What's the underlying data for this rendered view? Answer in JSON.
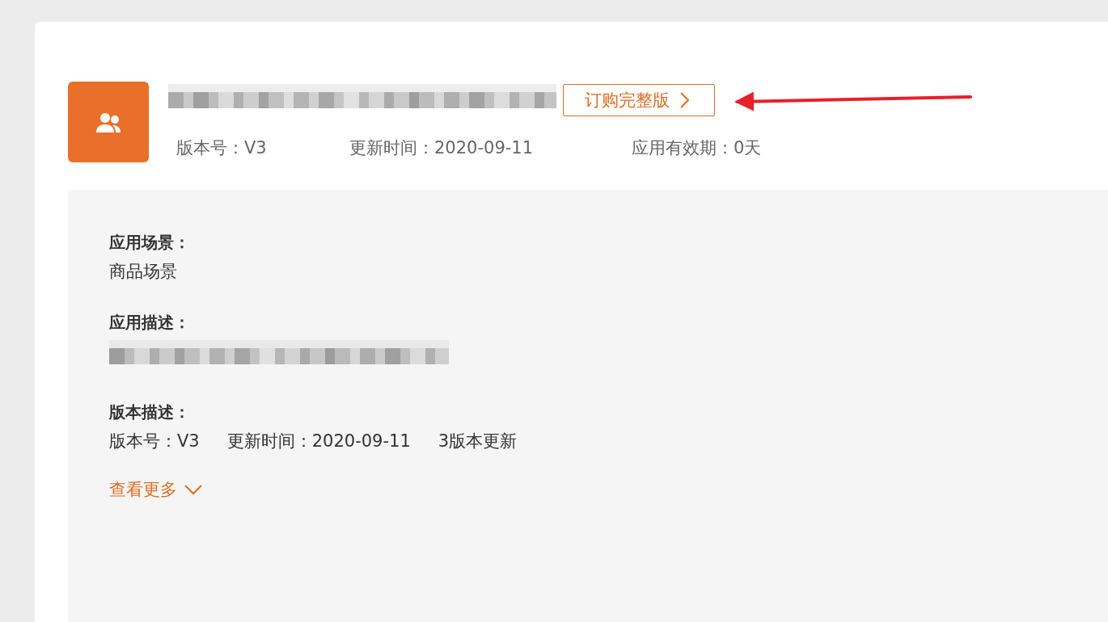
{
  "app_header": {
    "order_button": "订购完整版",
    "meta": [
      "版本号：V3",
      "更新时间：2020-09-11",
      "应用有效期：0天"
    ]
  },
  "details": {
    "sections": [
      {
        "kind": "text",
        "label": "应用场景：",
        "value": "商品场景"
      },
      {
        "kind": "redacted",
        "label": "应用描述："
      },
      {
        "kind": "version",
        "label": "版本描述：",
        "items": [
          "版本号：V3",
          "更新时间：2020-09-11",
          "3版本更新"
        ]
      }
    ],
    "more_link": "查看更多"
  }
}
